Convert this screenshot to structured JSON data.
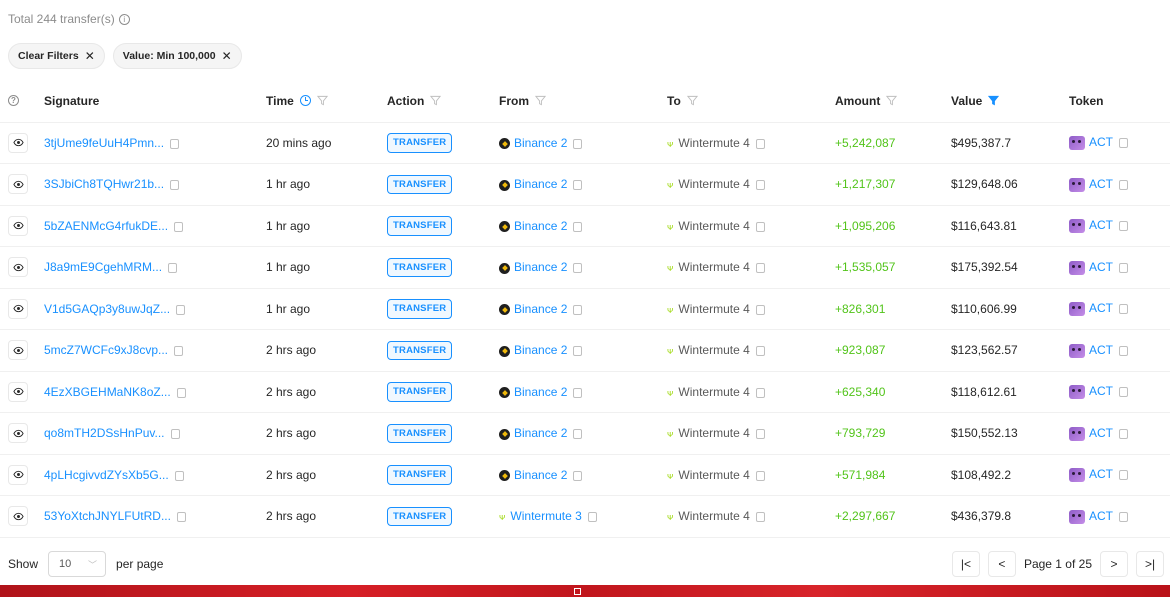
{
  "summary": {
    "text": "Total 244 transfer(s)"
  },
  "filters": [
    {
      "label": "Clear Filters"
    },
    {
      "label": "Value: Min 100,000"
    }
  ],
  "columns": {
    "signature": "Signature",
    "time": "Time",
    "action": "Action",
    "from": "From",
    "to": "To",
    "amount": "Amount",
    "value": "Value",
    "token": "Token"
  },
  "colors": {
    "link": "#1890ff",
    "positive": "#52c41a",
    "banner": "#d61f26"
  },
  "rows": [
    {
      "signature": "3tjUme9feUuH4Pmn...",
      "time": "20 mins ago",
      "action": "TRANSFER",
      "from": "Binance 2",
      "from_icon": "binance-icon",
      "to": "Wintermute 4",
      "amount": "+5,242,087",
      "value": "$495,387.7",
      "token": "ACT"
    },
    {
      "signature": "3SJbiCh8TQHwr21b...",
      "time": "1 hr ago",
      "action": "TRANSFER",
      "from": "Binance 2",
      "from_icon": "binance-icon",
      "to": "Wintermute 4",
      "amount": "+1,217,307",
      "value": "$129,648.06",
      "token": "ACT"
    },
    {
      "signature": "5bZAENMcG4rfukDE...",
      "time": "1 hr ago",
      "action": "TRANSFER",
      "from": "Binance 2",
      "from_icon": "binance-icon",
      "to": "Wintermute 4",
      "amount": "+1,095,206",
      "value": "$116,643.81",
      "token": "ACT"
    },
    {
      "signature": "J8a9mE9CgehMRM...",
      "time": "1 hr ago",
      "action": "TRANSFER",
      "from": "Binance 2",
      "from_icon": "binance-icon",
      "to": "Wintermute 4",
      "amount": "+1,535,057",
      "value": "$175,392.54",
      "token": "ACT"
    },
    {
      "signature": "V1d5GAQp3y8uwJqZ...",
      "time": "1 hr ago",
      "action": "TRANSFER",
      "from": "Binance 2",
      "from_icon": "binance-icon",
      "to": "Wintermute 4",
      "amount": "+826,301",
      "value": "$110,606.99",
      "token": "ACT"
    },
    {
      "signature": "5mcZ7WCFc9xJ8cvp...",
      "time": "2 hrs ago",
      "action": "TRANSFER",
      "from": "Binance 2",
      "from_icon": "binance-icon",
      "to": "Wintermute 4",
      "amount": "+923,087",
      "value": "$123,562.57",
      "token": "ACT"
    },
    {
      "signature": "4EzXBGEHMaNK8oZ...",
      "time": "2 hrs ago",
      "action": "TRANSFER",
      "from": "Binance 2",
      "from_icon": "binance-icon",
      "to": "Wintermute 4",
      "amount": "+625,340",
      "value": "$118,612.61",
      "token": "ACT"
    },
    {
      "signature": "qo8mTH2DSsHnPuv...",
      "time": "2 hrs ago",
      "action": "TRANSFER",
      "from": "Binance 2",
      "from_icon": "binance-icon",
      "to": "Wintermute 4",
      "amount": "+793,729",
      "value": "$150,552.13",
      "token": "ACT"
    },
    {
      "signature": "4pLHcgivvdZYsXb5G...",
      "time": "2 hrs ago",
      "action": "TRANSFER",
      "from": "Binance 2",
      "from_icon": "binance-icon",
      "to": "Wintermute 4",
      "amount": "+571,984",
      "value": "$108,492.2",
      "token": "ACT"
    },
    {
      "signature": "53YoXtchJNYLFUtRD...",
      "time": "2 hrs ago",
      "action": "TRANSFER",
      "from": "Wintermute 3",
      "from_icon": "wintermute-icon",
      "to": "Wintermute 4",
      "amount": "+2,297,667",
      "value": "$436,379.8",
      "token": "ACT"
    }
  ],
  "pagination": {
    "show_label": "Show",
    "per_page_value": "10",
    "per_page_label": "per page",
    "page_label": "Page 1 of 25"
  }
}
